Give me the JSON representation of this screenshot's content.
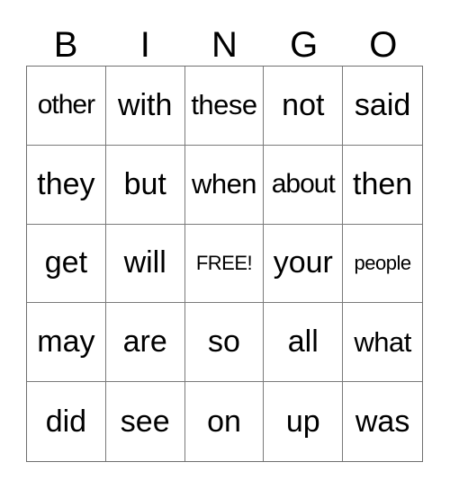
{
  "card": {
    "header": [
      "B",
      "I",
      "N",
      "G",
      "O"
    ],
    "rows": [
      [
        {
          "word": "other",
          "size": "sm"
        },
        {
          "word": "with",
          "size": "lg"
        },
        {
          "word": "these",
          "size": "md"
        },
        {
          "word": "not",
          "size": "lg"
        },
        {
          "word": "said",
          "size": "lg"
        }
      ],
      [
        {
          "word": "they",
          "size": "lg"
        },
        {
          "word": "but",
          "size": "lg"
        },
        {
          "word": "when",
          "size": "md"
        },
        {
          "word": "about",
          "size": "sm"
        },
        {
          "word": "then",
          "size": "lg"
        }
      ],
      [
        {
          "word": "get",
          "size": "lg"
        },
        {
          "word": "will",
          "size": "lg"
        },
        {
          "word": "FREE!",
          "size": "xs"
        },
        {
          "word": "your",
          "size": "lg"
        },
        {
          "word": "people",
          "size": "xs"
        }
      ],
      [
        {
          "word": "may",
          "size": "lg"
        },
        {
          "word": "are",
          "size": "lg"
        },
        {
          "word": "so",
          "size": "lg"
        },
        {
          "word": "all",
          "size": "lg"
        },
        {
          "word": "what",
          "size": "md"
        }
      ],
      [
        {
          "word": "did",
          "size": "lg"
        },
        {
          "word": "see",
          "size": "lg"
        },
        {
          "word": "on",
          "size": "lg"
        },
        {
          "word": "up",
          "size": "lg"
        },
        {
          "word": "was",
          "size": "lg"
        }
      ]
    ]
  }
}
